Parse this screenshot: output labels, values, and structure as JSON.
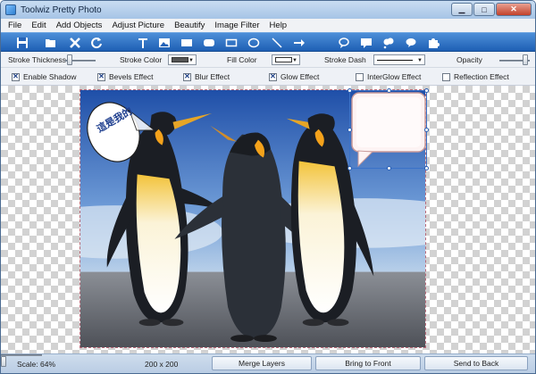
{
  "window": {
    "title": "Toolwiz Pretty Photo"
  },
  "menu": [
    "File",
    "Edit",
    "Add Objects",
    "Adjust Picture",
    "Beautify",
    "Image Filter",
    "Help"
  ],
  "props": {
    "stroke_thickness": "Stroke Thickness",
    "stroke_color": "Stroke Color",
    "stroke_color_value": "#555555",
    "fill_color": "Fill Color",
    "fill_color_value": "#ffffff",
    "stroke_dash": "Stroke Dash",
    "opacity": "Opacity"
  },
  "effects": [
    {
      "label": "Enable Shadow",
      "checked": true
    },
    {
      "label": "Bevels Effect",
      "checked": true
    },
    {
      "label": "Blur Effect",
      "checked": true
    },
    {
      "label": "Glow Effect",
      "checked": true
    },
    {
      "label": "InterGlow Effect",
      "checked": false
    },
    {
      "label": "Reflection Effect",
      "checked": false
    }
  ],
  "canvas": {
    "bubble_text": "這是我的"
  },
  "status": {
    "scale": "Scale: 64%",
    "size": "200 x 200",
    "merge": "Merge Layers",
    "front": "Bring to Front",
    "back": "Send to Back"
  }
}
